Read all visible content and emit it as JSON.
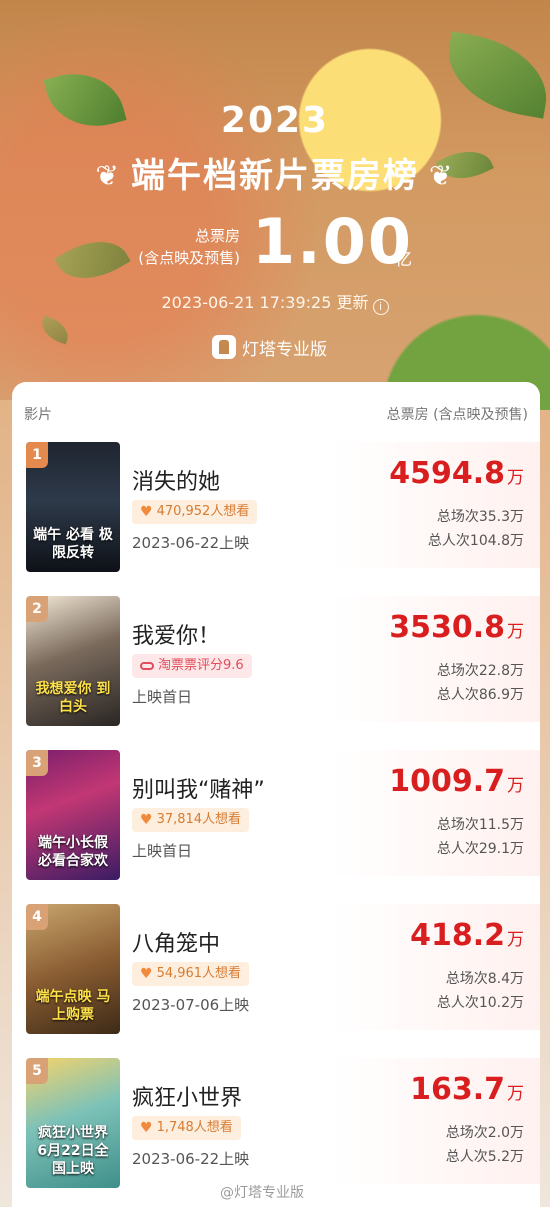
{
  "header": {
    "year": "2023",
    "title": "端午档新片票房榜",
    "total_label_line1": "总票房",
    "total_label_line2": "(含点映及预售)",
    "total_value": "1.00",
    "total_unit": "亿",
    "update_text": "2023-06-21 17:39:25 更新",
    "brand": "灯塔专业版"
  },
  "table": {
    "col_film": "影片",
    "col_box": "总票房 (含点映及预售)"
  },
  "movies": [
    {
      "rank": "1",
      "name": "消失的她",
      "tag": "470,952人想看",
      "tag_type": "want",
      "date": "2023-06-22上映",
      "box": "4594.8",
      "unit": "万",
      "shows": "总场次35.3万",
      "people": "总人次104.8万",
      "poster_text": "端午 必看 极限反转"
    },
    {
      "rank": "2",
      "name": "我爱你！",
      "tag": "淘票票评分9.6",
      "tag_type": "rating",
      "date": "上映首日",
      "box": "3530.8",
      "unit": "万",
      "shows": "总场次22.8万",
      "people": "总人次86.9万",
      "poster_text": "我想爱你 到白头"
    },
    {
      "rank": "3",
      "name": "别叫我“赌神”",
      "tag": "37,814人想看",
      "tag_type": "want",
      "date": "上映首日",
      "box": "1009.7",
      "unit": "万",
      "shows": "总场次11.5万",
      "people": "总人次29.1万",
      "poster_text": "端午小长假 必看合家欢"
    },
    {
      "rank": "4",
      "name": "八角笼中",
      "tag": "54,961人想看",
      "tag_type": "want",
      "date": "2023-07-06上映",
      "box": "418.2",
      "unit": "万",
      "shows": "总场次8.4万",
      "people": "总人次10.2万",
      "poster_text": "端午点映 马上购票"
    },
    {
      "rank": "5",
      "name": "疯狂小世界",
      "tag": "1,748人想看",
      "tag_type": "want",
      "date": "2023-06-22上映",
      "box": "163.7",
      "unit": "万",
      "shows": "总场次2.0万",
      "people": "总人次5.2万",
      "poster_text": "疯狂小世界 6月22日全国上映"
    }
  ],
  "watermark": "@灯塔专业版"
}
